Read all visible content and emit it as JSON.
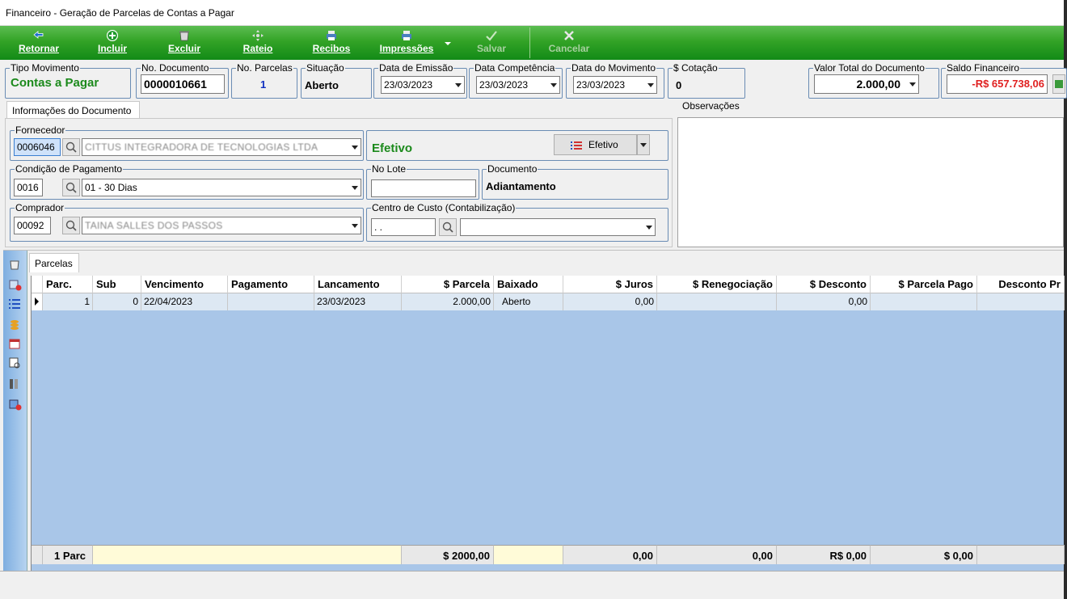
{
  "window": {
    "title": "Financeiro - Geração de Parcelas de Contas a Pagar"
  },
  "toolbar": {
    "retornar": "Retornar",
    "incluir": "Incluir",
    "excluir": "Excluir",
    "rateio": "Rateio",
    "recibos": "Recibos",
    "impressoes": "Impressões",
    "salvar": "Salvar",
    "cancelar": "Cancelar"
  },
  "header": {
    "tipo_movimento": {
      "label": "Tipo Movimento",
      "value": "Contas a Pagar"
    },
    "no_documento": {
      "label": "No. Documento",
      "value": "0000010661"
    },
    "no_parcelas": {
      "label": "No. Parcelas",
      "value": "1"
    },
    "situacao": {
      "label": "Situação",
      "value": "Aberto"
    },
    "data_emissao": {
      "label": "Data de Emissão",
      "value": "23/03/2023"
    },
    "data_competencia": {
      "label": "Data Competência",
      "value": "23/03/2023"
    },
    "data_movimento": {
      "label": "Data do Movimento",
      "value": "23/03/2023"
    },
    "cotacao": {
      "label": "$ Cotação",
      "value": "0"
    },
    "valor_total": {
      "label": "Valor Total do Documento",
      "value": "2.000,00"
    },
    "saldo_financeiro": {
      "label": "Saldo Financeiro",
      "value": "-R$ 657.738,06"
    }
  },
  "doc": {
    "tab_label": "Informações do Documento",
    "fornecedor": {
      "label": "Fornecedor",
      "code": "0006046",
      "name": "CITTUS INTEGRADORA DE TECNOLOGIAS LTDA"
    },
    "efetivo_text": "Efetivo",
    "efetivo_button": "Efetivo",
    "condicao": {
      "label": "Condição de Pagamento",
      "code": "0016",
      "name": "01 - 30 Dias"
    },
    "no_lote": {
      "label": "No Lote",
      "value": ""
    },
    "documento": {
      "label": "Documento",
      "value": "Adiantamento"
    },
    "comprador": {
      "label": "Comprador",
      "code": "00092",
      "name": "TAINA SALLES DOS PASSOS"
    },
    "centro_custo": {
      "label": "Centro de Custo (Contabilização)",
      "code": ".  .",
      "name": ""
    }
  },
  "observacoes": {
    "label": "Observações",
    "text": ""
  },
  "parcelas": {
    "tab_label": "Parcelas",
    "columns": [
      "Parc.",
      "Sub",
      "Vencimento",
      "Pagamento",
      "Lancamento",
      "$ Parcela",
      "Baixado",
      "$ Juros",
      "$ Renegociação",
      "$ Desconto",
      "$ Parcela Pago",
      "Desconto Pr"
    ],
    "rows": [
      {
        "parc": "1",
        "sub": "0",
        "vencimento": "22/04/2023",
        "pagamento": "",
        "lancamento": "23/03/2023",
        "parcela": "2.000,00",
        "baixado": "Aberto",
        "juros": "0,00",
        "renegociacao": "",
        "desconto": "0,00",
        "parcela_pago": "",
        "desconto_pr": ""
      }
    ],
    "footer": {
      "parc": "1 Parc",
      "parcela": "$ 2000,00",
      "juros": "0,00",
      "renegociacao": "0,00",
      "desconto": "R$ 0,00",
      "parcela_pago": "$ 0,00"
    }
  },
  "colors": {
    "toolbar": "#33a326",
    "grid_bg": "#a9c6e8",
    "negative": "#e02020",
    "green_text": "#1c8a1c"
  }
}
